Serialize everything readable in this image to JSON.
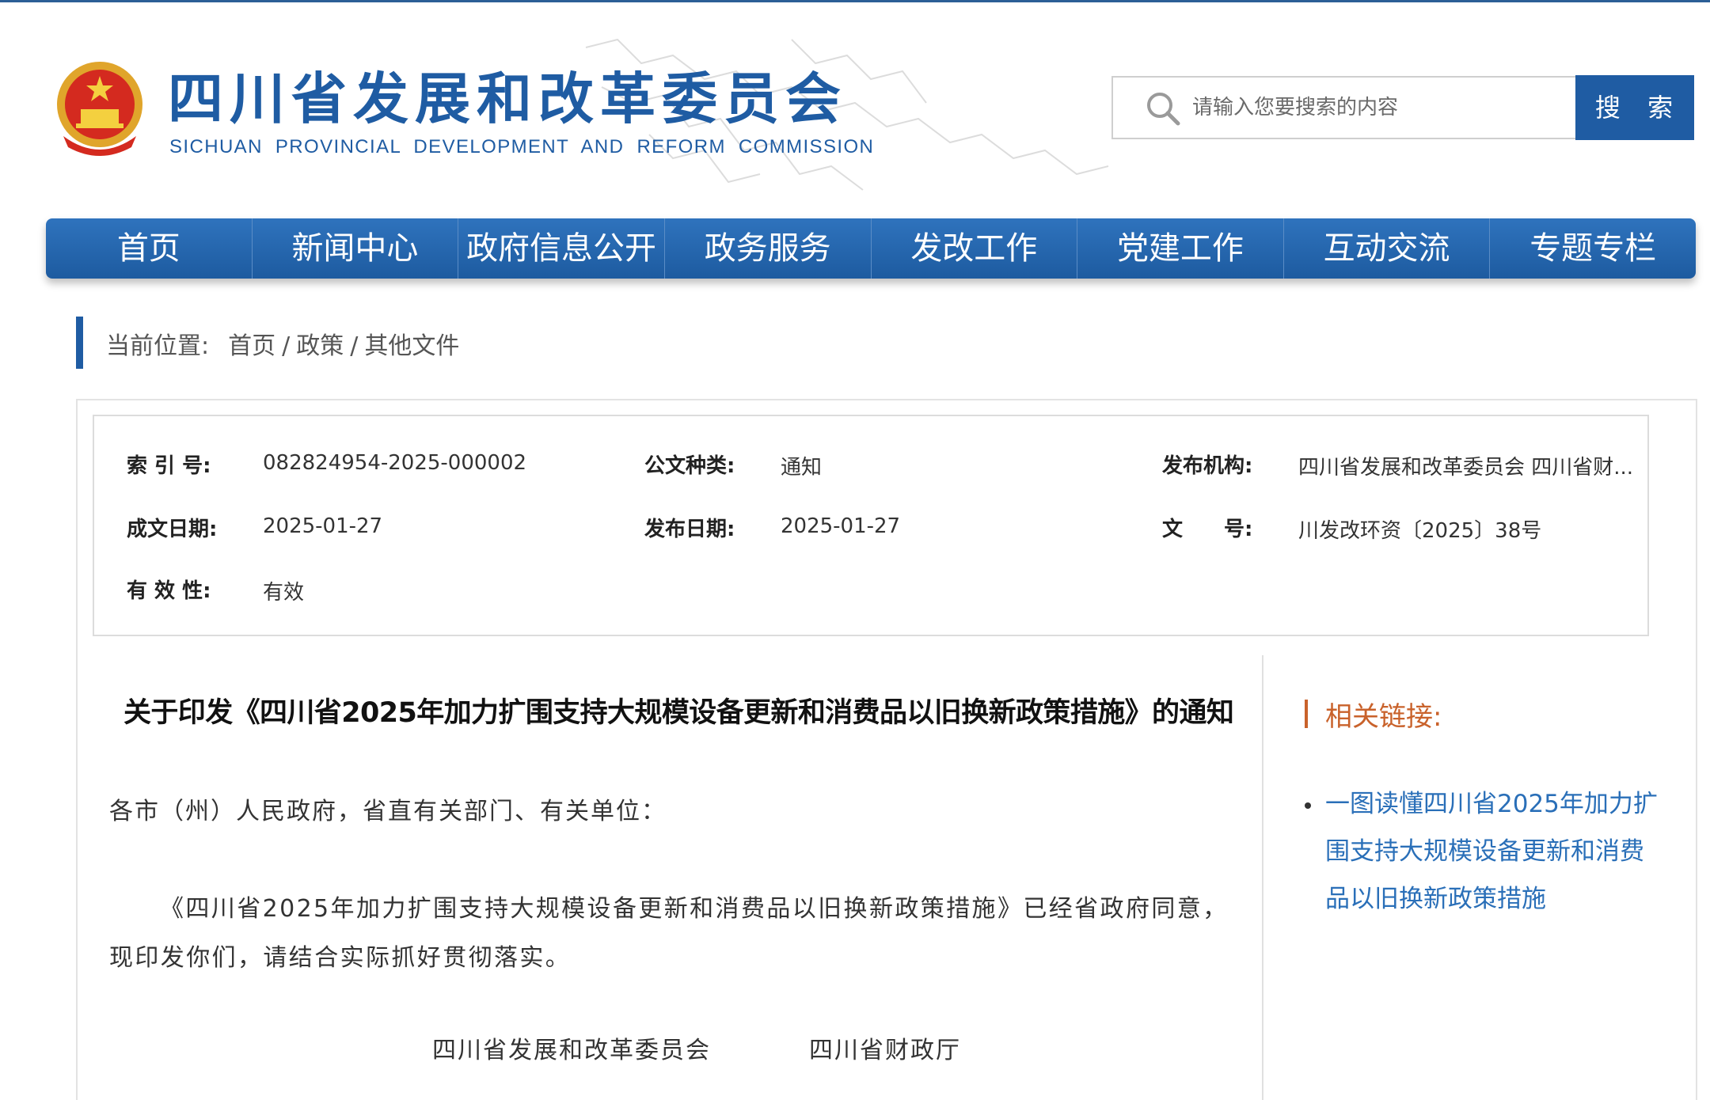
{
  "header": {
    "site_title": "四川省发展和改革委员会",
    "site_subtitle": "SICHUAN PROVINCIAL DEVELOPMENT AND REFORM COMMISSION",
    "search_placeholder": "请输入您要搜索的内容",
    "search_button": "搜 索"
  },
  "nav": {
    "items": [
      "首页",
      "新闻中心",
      "政府信息公开",
      "政务服务",
      "发改工作",
      "党建工作",
      "互动交流",
      "专题专栏"
    ]
  },
  "breadcrumb": {
    "label": "当前位置:",
    "items": [
      "首页",
      "政策",
      "其他文件"
    ],
    "separator": "/"
  },
  "meta": {
    "index_label": "索 引 号:",
    "index_value": "082824954-2025-000002",
    "doctype_label": "公文种类:",
    "doctype_value": "通知",
    "publisher_label": "发布机构:",
    "publisher_value": "四川省发展和改革委员会 四川省财...",
    "written_label": "成文日期:",
    "written_value": "2025-01-27",
    "published_label": "发布日期:",
    "published_value": "2025-01-27",
    "docno_label": "文　　号:",
    "docno_value": "川发改环资〔2025〕38号",
    "validity_label": "有 效 性:",
    "validity_value": "有效"
  },
  "article": {
    "title": "关于印发《四川省2025年加力扩围支持大规模设备更新和消费品以旧换新政策措施》的通知",
    "greeting": "各市（州）人民政府，省直有关部门、有关单位：",
    "body": "《四川省2025年加力扩围支持大规模设备更新和消费品以旧换新政策措施》已经省政府同意，现印发你们，请结合实际抓好贯彻落实。",
    "signatory_1": "四川省发展和改革委员会",
    "signatory_2": "四川省财政厅"
  },
  "related": {
    "title": "相关链接:",
    "links": [
      "一图读懂四川省2025年加力扩围支持大规模设备更新和消费品以旧换新政策措施"
    ]
  },
  "colors": {
    "brand_blue": "#1f5ca3",
    "accent_orange": "#c9622b",
    "link_blue": "#2a6fb8"
  },
  "icons": {
    "emblem": "national-emblem-icon",
    "search": "search-icon",
    "map": "map-watermark"
  }
}
